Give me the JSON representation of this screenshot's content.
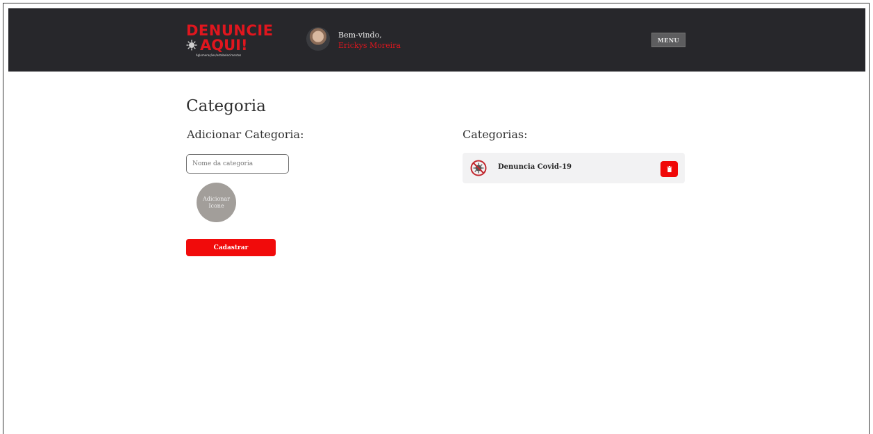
{
  "header": {
    "logo_line1": "DENUNCIE",
    "logo_line2": "AQUI!",
    "logo_tagline": "Aglomerações/estabelecimentos",
    "welcome": "Bem-vindo,",
    "user_name": "Erickys Moreira",
    "menu_label": "MENU"
  },
  "page": {
    "title": "Categoria"
  },
  "form": {
    "heading": "Adicionar Categoria:",
    "name_placeholder": "Nome da categoria",
    "name_value": "",
    "icon_button_label": "Adicionar Icone",
    "submit_label": "Cadastrar"
  },
  "categories": {
    "heading": "Categorias:",
    "items": [
      {
        "name": "Denuncia Covid-19",
        "icon": "virus-prohibited-icon"
      }
    ]
  },
  "colors": {
    "topbar": "#27272b",
    "brand_red": "#e0161e",
    "button_red": "#f10b0b",
    "icon_placeholder": "#a29e9a"
  }
}
